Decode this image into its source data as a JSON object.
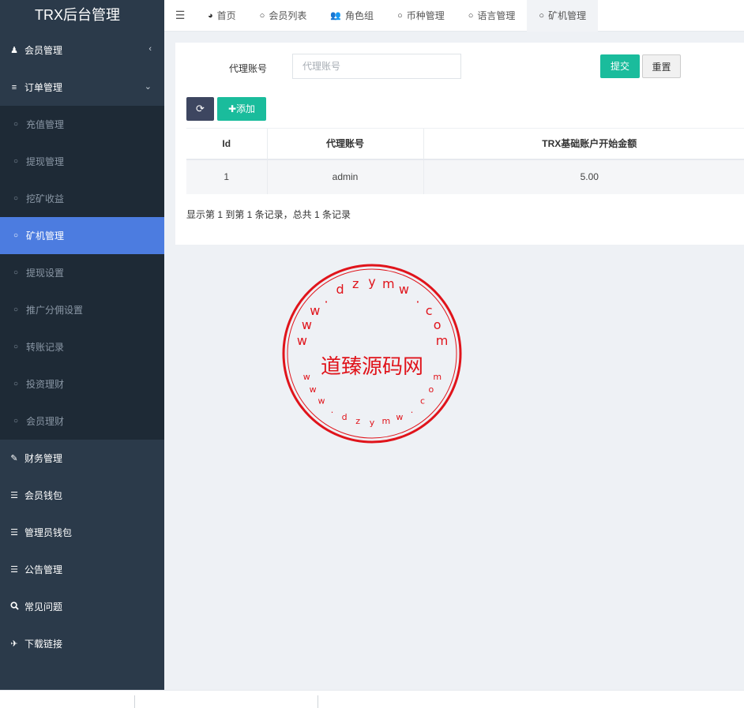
{
  "app_title": "TRX后台管理",
  "sidebar": {
    "items": [
      {
        "label": "会员管理",
        "icon": "user-icon",
        "glyph": "♟",
        "arrow": "‹"
      },
      {
        "label": "订单管理",
        "icon": "list-icon",
        "glyph": "≡",
        "arrow": "⌄"
      }
    ],
    "submenu": [
      {
        "label": "充值管理",
        "icon": "circle-icon"
      },
      {
        "label": "提现管理",
        "icon": "circle-icon"
      },
      {
        "label": "挖矿收益",
        "icon": "circle-icon"
      },
      {
        "label": "矿机管理",
        "icon": "circle-icon",
        "active": true
      },
      {
        "label": "提现设置",
        "icon": "circle-icon"
      },
      {
        "label": "推广分佣设置",
        "icon": "circle-icon"
      },
      {
        "label": "转账记录",
        "icon": "circle-icon"
      },
      {
        "label": "投资理财",
        "icon": "circle-icon"
      },
      {
        "label": "会员理财",
        "icon": "circle-icon"
      }
    ],
    "lower_items": [
      {
        "label": "财务管理",
        "icon": "edit-icon",
        "glyph": "✎"
      },
      {
        "label": "会员钱包",
        "icon": "list-alt-icon",
        "glyph": "☰"
      },
      {
        "label": "管理员钱包",
        "icon": "list-icon",
        "glyph": "☰"
      },
      {
        "label": "公告管理",
        "icon": "list-icon",
        "glyph": "☰"
      },
      {
        "label": "常见问题",
        "icon": "search-icon",
        "glyph": "🔍"
      },
      {
        "label": "下载链接",
        "icon": "plane-icon",
        "glyph": "✈"
      }
    ]
  },
  "topnav": {
    "tabs": [
      {
        "label": "首页",
        "icon": "dashboard-icon",
        "glyph": "◕"
      },
      {
        "label": "会员列表",
        "icon": "circle-icon",
        "glyph": "○"
      },
      {
        "label": "角色组",
        "icon": "group-icon",
        "glyph": "👥"
      },
      {
        "label": "币种管理",
        "icon": "circle-icon",
        "glyph": "○"
      },
      {
        "label": "语言管理",
        "icon": "circle-icon",
        "glyph": "○"
      },
      {
        "label": "矿机管理",
        "icon": "circle-icon",
        "glyph": "○",
        "active": true
      }
    ]
  },
  "search": {
    "label": "代理账号",
    "placeholder": "代理账号",
    "submit": "提交",
    "reset": "重置"
  },
  "toolbar": {
    "add": "添加"
  },
  "table": {
    "columns": [
      "Id",
      "代理账号",
      "TRX基础账户开始金额"
    ],
    "rows": [
      [
        "1",
        "admin",
        "5.00"
      ]
    ]
  },
  "pagination": {
    "info": "显示第 1 到第 1 条记录，总共 1 条记录"
  },
  "stamp": {
    "center_text": "道臻源码网",
    "top_text": "www.dzymw.com",
    "bottom_text": "www.dzymw.com",
    "color": "#e0141b"
  },
  "colors": {
    "sidebar_bg": "#2b3a4a",
    "submenu_bg": "#1e2a36",
    "active": "#4c7ce0",
    "accent": "#1abc9c"
  }
}
